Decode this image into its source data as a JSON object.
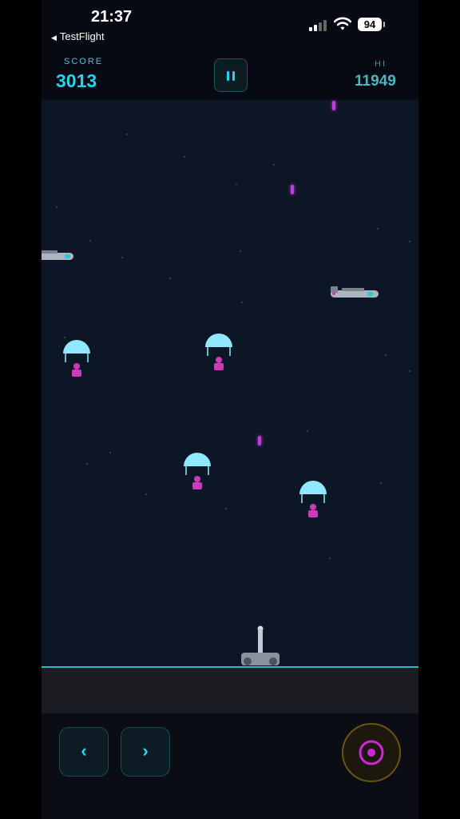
{
  "status_bar": {
    "time": "21:37",
    "back_label": "TestFlight",
    "battery": "94"
  },
  "hud": {
    "score_label": "SCORE",
    "score": "3013",
    "hi_label": "HI",
    "hi_score": "11949",
    "pause_icon": "pause-icon"
  },
  "colors": {
    "accent": "#21d4f0",
    "bullet": "#ba3ddc",
    "paratrooper": "#c93bb8",
    "parachute": "#8fe8ff",
    "ground_line": "#2ab8c6",
    "fire_button_ring": "#6a5414"
  },
  "controls": {
    "left_icon": "‹",
    "right_icon": "›",
    "fire_icon": "target-icon"
  }
}
